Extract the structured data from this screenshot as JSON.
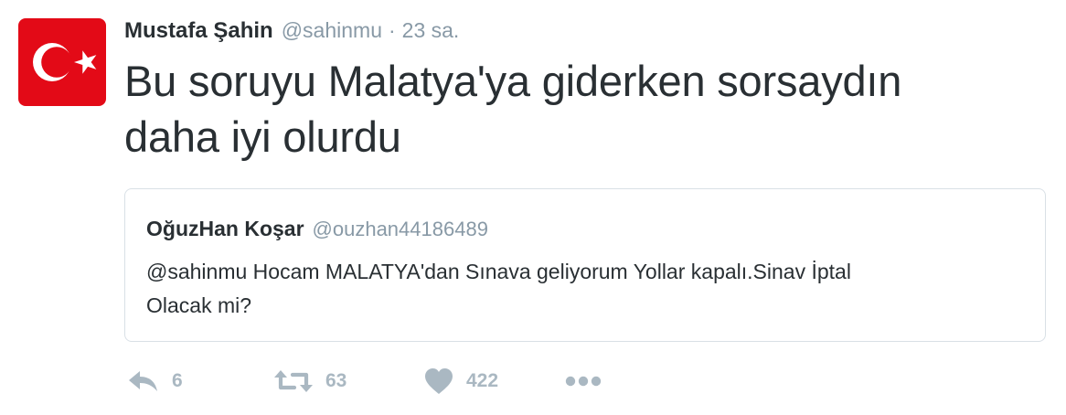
{
  "tweet": {
    "author": {
      "fullname": "Mustafa Şahin",
      "username": "@sahinmu",
      "avatar_icon": "turkish-flag-avatar"
    },
    "separator": "·",
    "time": "23 sa.",
    "text_line1": "Bu soruyu Malatya'ya giderken sorsaydın",
    "text_line2": "daha iyi olurdu"
  },
  "quote": {
    "fullname": "OğuzHan Koşar",
    "username": "@ouzhan44186489",
    "text_line1": "@sahinmu Hocam MALATYA'dan Sınava geliyorum Yollar kapalı.Sinav İptal",
    "text_line2": "Olacak mi?"
  },
  "actions": {
    "reply": {
      "icon": "reply-icon",
      "count": "6"
    },
    "retweet": {
      "icon": "retweet-icon",
      "count": "63"
    },
    "like": {
      "icon": "heart-icon",
      "count": "422"
    },
    "more": {
      "icon": "more-icon"
    }
  },
  "colors": {
    "text": "#292f33",
    "muted": "#8899a6",
    "action": "#aab8c2",
    "border": "#d9e0e6",
    "flag_red": "#e30a17",
    "flag_white": "#ffffff"
  }
}
